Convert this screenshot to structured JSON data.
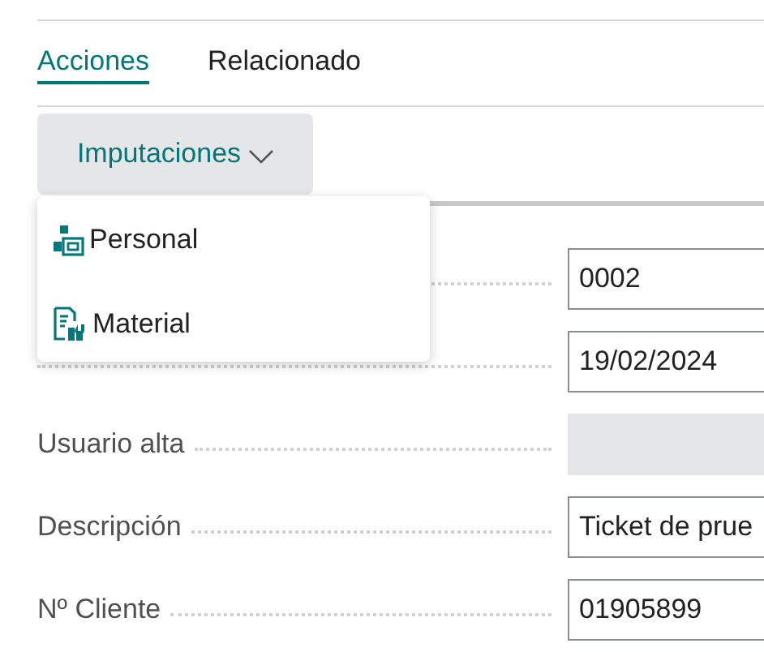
{
  "tabs": [
    {
      "label": "Acciones",
      "selected": true
    },
    {
      "label": "Relacionado",
      "selected": false
    }
  ],
  "action_button": {
    "label": "Imputaciones",
    "expanded": true
  },
  "menu": {
    "items": [
      {
        "label": "Personal",
        "kind": "personal"
      },
      {
        "label": "Material",
        "kind": "material"
      }
    ]
  },
  "fields": [
    {
      "value": "0002",
      "disabled": false
    },
    {
      "value": "19/02/2024",
      "disabled": false
    },
    {
      "label": "Usuario alta",
      "disabled": true
    },
    {
      "label": "Descripción",
      "value": "Ticket de prue",
      "disabled": false
    },
    {
      "label": "Nº Cliente",
      "value": "01905899",
      "disabled": false
    }
  ]
}
